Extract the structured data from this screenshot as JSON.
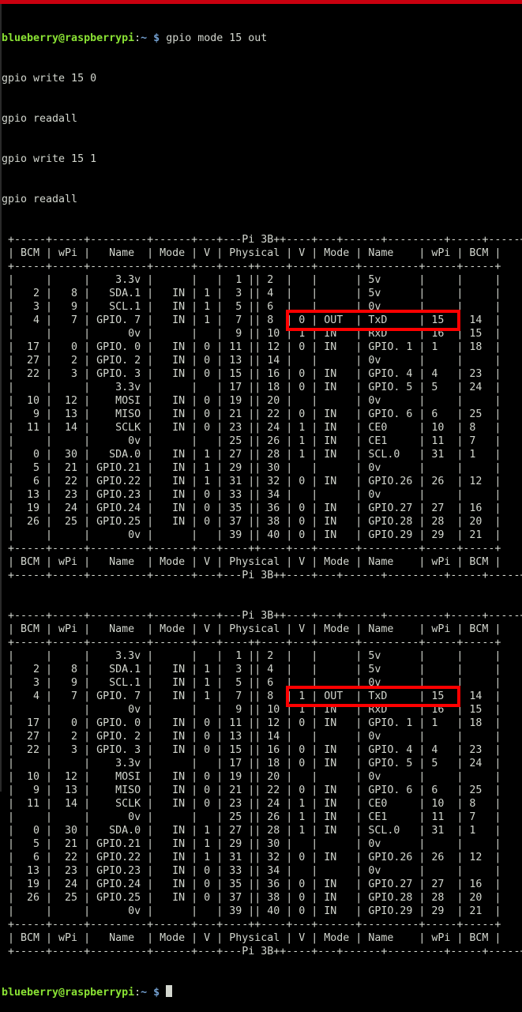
{
  "terminal": {
    "prompt_user_host": "blueberry@raspberrypi",
    "prompt_sep": ":",
    "prompt_path": "~",
    "prompt_symbol": "$",
    "first_command": "gpio mode 15 out",
    "queued_lines": [
      "gpio write 15 0",
      "gpio readall",
      "gpio write 15 1",
      "gpio readall"
    ],
    "highlight_color": "#ff0000",
    "user_color": "#8ae234",
    "path_color": "#729fcf"
  },
  "readall_1": {
    "title": "Pi 3B+",
    "headers": [
      "BCM",
      "wPi",
      "Name",
      "Mode",
      "V",
      "Physical",
      "V",
      "Mode",
      "Name",
      "wPi",
      "BCM"
    ],
    "rows": [
      [
        "",
        "",
        "3.3v",
        "",
        "",
        "1",
        "2",
        "",
        "",
        "5v",
        "",
        ""
      ],
      [
        "2",
        "8",
        "SDA.1",
        "IN",
        "1",
        "3",
        "4",
        "",
        "",
        "5v",
        "",
        ""
      ],
      [
        "3",
        "9",
        "SCL.1",
        "IN",
        "1",
        "5",
        "6",
        "",
        "",
        "0v",
        "",
        ""
      ],
      [
        "4",
        "7",
        "GPIO. 7",
        "IN",
        "1",
        "7",
        "8",
        "0",
        "OUT",
        "TxD",
        "15",
        "14"
      ],
      [
        "",
        "",
        "0v",
        "",
        "",
        "9",
        "10",
        "1",
        "IN",
        "RxD",
        "16",
        "15"
      ],
      [
        "17",
        "0",
        "GPIO. 0",
        "IN",
        "0",
        "11",
        "12",
        "0",
        "IN",
        "GPIO. 1",
        "1",
        "18"
      ],
      [
        "27",
        "2",
        "GPIO. 2",
        "IN",
        "0",
        "13",
        "14",
        "",
        "",
        "0v",
        "",
        ""
      ],
      [
        "22",
        "3",
        "GPIO. 3",
        "IN",
        "0",
        "15",
        "16",
        "0",
        "IN",
        "GPIO. 4",
        "4",
        "23"
      ],
      [
        "",
        "",
        "3.3v",
        "",
        "",
        "17",
        "18",
        "0",
        "IN",
        "GPIO. 5",
        "5",
        "24"
      ],
      [
        "10",
        "12",
        "MOSI",
        "IN",
        "0",
        "19",
        "20",
        "",
        "",
        "0v",
        "",
        ""
      ],
      [
        "9",
        "13",
        "MISO",
        "IN",
        "0",
        "21",
        "22",
        "0",
        "IN",
        "GPIO. 6",
        "6",
        "25"
      ],
      [
        "11",
        "14",
        "SCLK",
        "IN",
        "0",
        "23",
        "24",
        "1",
        "IN",
        "CE0",
        "10",
        "8"
      ],
      [
        "",
        "",
        "0v",
        "",
        "",
        "25",
        "26",
        "1",
        "IN",
        "CE1",
        "11",
        "7"
      ],
      [
        "0",
        "30",
        "SDA.0",
        "IN",
        "1",
        "27",
        "28",
        "1",
        "IN",
        "SCL.0",
        "31",
        "1"
      ],
      [
        "5",
        "21",
        "GPIO.21",
        "IN",
        "1",
        "29",
        "30",
        "",
        "",
        "0v",
        "",
        ""
      ],
      [
        "6",
        "22",
        "GPIO.22",
        "IN",
        "1",
        "31",
        "32",
        "0",
        "IN",
        "GPIO.26",
        "26",
        "12"
      ],
      [
        "13",
        "23",
        "GPIO.23",
        "IN",
        "0",
        "33",
        "34",
        "",
        "",
        "0v",
        "",
        ""
      ],
      [
        "19",
        "24",
        "GPIO.24",
        "IN",
        "0",
        "35",
        "36",
        "0",
        "IN",
        "GPIO.27",
        "27",
        "16"
      ],
      [
        "26",
        "25",
        "GPIO.25",
        "IN",
        "0",
        "37",
        "38",
        "0",
        "IN",
        "GPIO.28",
        "28",
        "20"
      ],
      [
        "",
        "",
        "0v",
        "",
        "",
        "39",
        "40",
        "0",
        "IN",
        "GPIO.29",
        "29",
        "21"
      ]
    ]
  },
  "readall_2": {
    "title": "Pi 3B+",
    "headers": [
      "BCM",
      "wPi",
      "Name",
      "Mode",
      "V",
      "Physical",
      "V",
      "Mode",
      "Name",
      "wPi",
      "BCM"
    ],
    "rows": [
      [
        "",
        "",
        "3.3v",
        "",
        "",
        "1",
        "2",
        "",
        "",
        "5v",
        "",
        ""
      ],
      [
        "2",
        "8",
        "SDA.1",
        "IN",
        "1",
        "3",
        "4",
        "",
        "",
        "5v",
        "",
        ""
      ],
      [
        "3",
        "9",
        "SCL.1",
        "IN",
        "1",
        "5",
        "6",
        "",
        "",
        "0v",
        "",
        ""
      ],
      [
        "4",
        "7",
        "GPIO. 7",
        "IN",
        "1",
        "7",
        "8",
        "1",
        "OUT",
        "TxD",
        "15",
        "14"
      ],
      [
        "",
        "",
        "0v",
        "",
        "",
        "9",
        "10",
        "1",
        "IN",
        "RxD",
        "16",
        "15"
      ],
      [
        "17",
        "0",
        "GPIO. 0",
        "IN",
        "0",
        "11",
        "12",
        "0",
        "IN",
        "GPIO. 1",
        "1",
        "18"
      ],
      [
        "27",
        "2",
        "GPIO. 2",
        "IN",
        "0",
        "13",
        "14",
        "",
        "",
        "0v",
        "",
        ""
      ],
      [
        "22",
        "3",
        "GPIO. 3",
        "IN",
        "0",
        "15",
        "16",
        "0",
        "IN",
        "GPIO. 4",
        "4",
        "23"
      ],
      [
        "",
        "",
        "3.3v",
        "",
        "",
        "17",
        "18",
        "0",
        "IN",
        "GPIO. 5",
        "5",
        "24"
      ],
      [
        "10",
        "12",
        "MOSI",
        "IN",
        "0",
        "19",
        "20",
        "",
        "",
        "0v",
        "",
        ""
      ],
      [
        "9",
        "13",
        "MISO",
        "IN",
        "0",
        "21",
        "22",
        "0",
        "IN",
        "GPIO. 6",
        "6",
        "25"
      ],
      [
        "11",
        "14",
        "SCLK",
        "IN",
        "0",
        "23",
        "24",
        "1",
        "IN",
        "CE0",
        "10",
        "8"
      ],
      [
        "",
        "",
        "0v",
        "",
        "",
        "25",
        "26",
        "1",
        "IN",
        "CE1",
        "11",
        "7"
      ],
      [
        "0",
        "30",
        "SDA.0",
        "IN",
        "1",
        "27",
        "28",
        "1",
        "IN",
        "SCL.0",
        "31",
        "1"
      ],
      [
        "5",
        "21",
        "GPIO.21",
        "IN",
        "1",
        "29",
        "30",
        "",
        "",
        "0v",
        "",
        ""
      ],
      [
        "6",
        "22",
        "GPIO.22",
        "IN",
        "1",
        "31",
        "32",
        "0",
        "IN",
        "GPIO.26",
        "26",
        "12"
      ],
      [
        "13",
        "23",
        "GPIO.23",
        "IN",
        "0",
        "33",
        "34",
        "",
        "",
        "0v",
        "",
        ""
      ],
      [
        "19",
        "24",
        "GPIO.24",
        "IN",
        "0",
        "35",
        "36",
        "0",
        "IN",
        "GPIO.27",
        "27",
        "16"
      ],
      [
        "26",
        "25",
        "GPIO.25",
        "IN",
        "0",
        "37",
        "38",
        "0",
        "IN",
        "GPIO.28",
        "28",
        "20"
      ],
      [
        "",
        "",
        "0v",
        "",
        "",
        "39",
        "40",
        "0",
        "IN",
        "GPIO.29",
        "29",
        "21"
      ]
    ]
  }
}
